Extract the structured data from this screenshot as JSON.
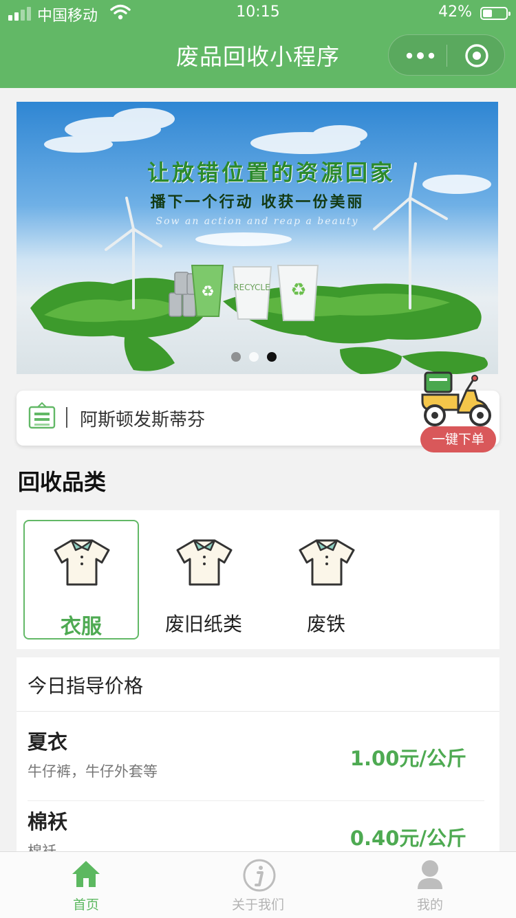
{
  "status_bar": {
    "carrier": "中国移动",
    "time": "10:15",
    "battery_percent": "42%",
    "battery_level": 0.42
  },
  "navbar": {
    "title": "废品回收小程序",
    "more_icon": "more-dots-icon",
    "close_icon": "target-circle-icon"
  },
  "banner": {
    "title": "让放错位置的资源回家",
    "subtitle": "播下一个行动 收获一份美丽",
    "english": "Sow an action and reap a beauty",
    "bin_label": "RECYCLE",
    "slide_count": 3,
    "active_slide": 3
  },
  "notice": {
    "icon": "shopping-bag-icon",
    "text": "阿斯顿发斯蒂芬"
  },
  "order_button": {
    "icon": "delivery-scooter-icon",
    "label": "一键下单"
  },
  "categories": {
    "title": "回收品类",
    "items": [
      {
        "label": "衣服",
        "icon": "shirt-icon",
        "selected": true
      },
      {
        "label": "废旧纸类",
        "icon": "shirt-icon",
        "selected": false
      },
      {
        "label": "废铁",
        "icon": "shirt-icon",
        "selected": false
      }
    ]
  },
  "prices": {
    "title": "今日指导价格",
    "items": [
      {
        "name": "夏衣",
        "desc": "牛仔裤，牛仔外套等",
        "price": "1.00元/公斤"
      },
      {
        "name": "棉袄",
        "desc": "棉袄",
        "price": "0.40元/公斤"
      }
    ]
  },
  "tabbar": {
    "items": [
      {
        "label": "首页",
        "icon": "home-icon",
        "active": true
      },
      {
        "label": "关于我们",
        "icon": "info-icon",
        "active": false
      },
      {
        "label": "我的",
        "icon": "user-icon",
        "active": false
      }
    ]
  },
  "colors": {
    "brand_green": "#62b866",
    "price_green": "#4eaa52",
    "order_red": "#d9585a"
  }
}
